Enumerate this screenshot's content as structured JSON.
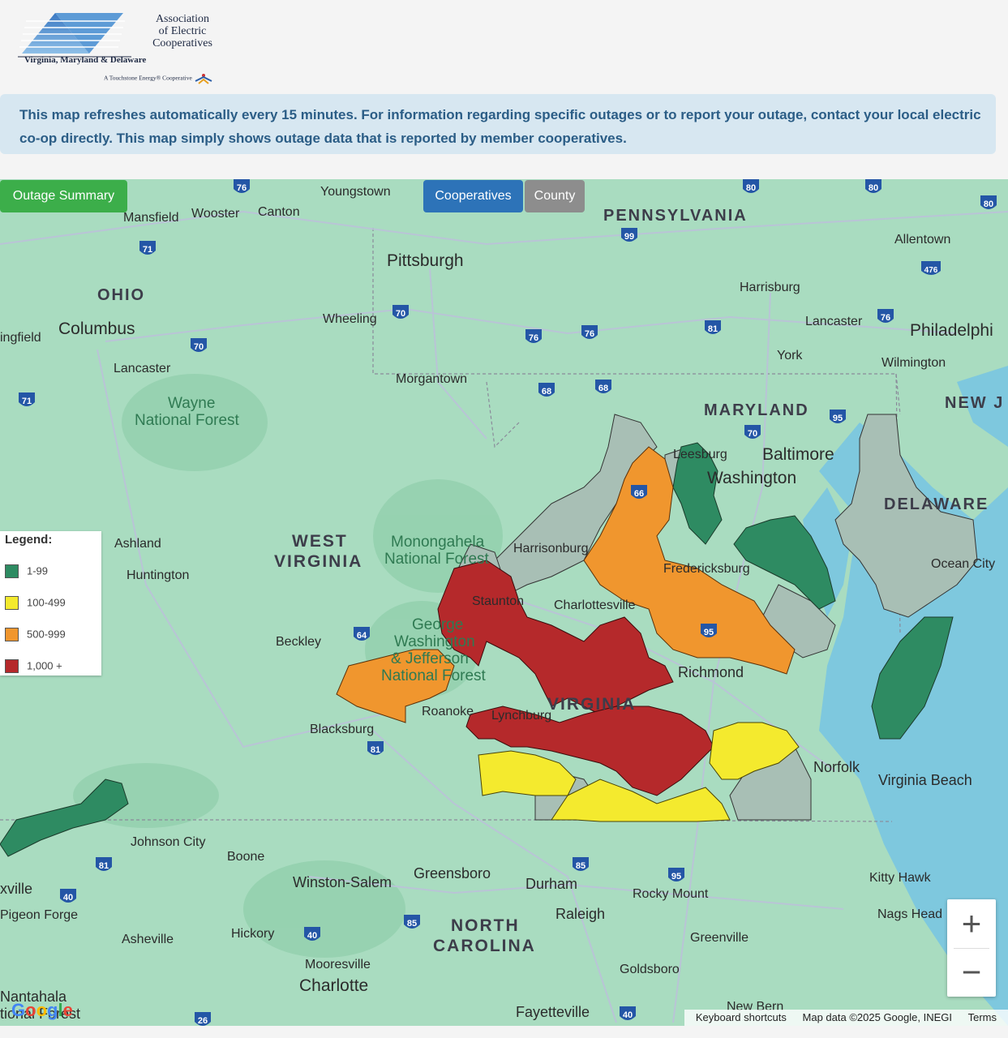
{
  "logo": {
    "name_line1": "Association",
    "name_line2": "of Electric",
    "name_line3": "Cooperatives",
    "states": "Virginia, Maryland & Delaware",
    "tagline": "A Touchstone Energy® Cooperative"
  },
  "banner": {
    "text": "This map refreshes automatically every 15 minutes. For information regarding specific outages or to report your outage, contact your local electric co-op directly. This map simply shows outage data that is reported by member cooperatives."
  },
  "buttons": {
    "outage_summary": "Outage Summary",
    "cooperatives": "Cooperatives",
    "county": "County"
  },
  "legend": {
    "title": "Legend:",
    "items": [
      {
        "label": "1-99",
        "color": "#2e8b62"
      },
      {
        "label": "100-499",
        "color": "#f4ea2e"
      },
      {
        "label": "500-999",
        "color": "#f0962e"
      },
      {
        "label": "1,000 +",
        "color": "#b5292b"
      }
    ]
  },
  "colors": {
    "no_outage": "#a8bfb5",
    "water": "#7ec8de",
    "land": "#a9dcc0"
  },
  "map_labels": {
    "states": [
      "PENNSYLVANIA",
      "OHIO",
      "MARYLAND",
      "NEW J",
      "WEST",
      "VIRGINIA",
      "DELAWARE",
      "NORTH",
      "CAROLINA",
      "VIRGINIA"
    ],
    "cities": [
      "Youngstown",
      "Mansfield",
      "Wooster",
      "Canton",
      "Pittsburgh",
      "Allentown",
      "Harrisburg",
      "Lancaster",
      "Philadelphi",
      "Wheeling",
      "Columbus",
      "ingfield",
      "Lancaster",
      "York",
      "Wilmington",
      "Morgantown",
      "Baltimore",
      "Washington",
      "Leesburg",
      "Ashland",
      "Huntington",
      "Harrisonburg",
      "Staunton",
      "Charlottesville",
      "Fredericksburg",
      "Ocean City",
      "Beckley",
      "Richmond",
      "Roanoke",
      "Lynchburg",
      "Blacksburg",
      "Norfolk",
      "Virginia Beach",
      "Johnson City",
      "Boone",
      "Winston-Salem",
      "Greensboro",
      "Durham",
      "Rocky Mount",
      "Kitty Hawk",
      "Raleigh",
      "Nags Head",
      "Hickory",
      "Asheville",
      "Greenville",
      "Mooresville",
      "Charlotte",
      "Goldsboro",
      "Fayetteville",
      "New Bern",
      "xville",
      "Pigeon Forge",
      "Nantahala",
      "tional Forest"
    ],
    "forests": [
      "Wayne",
      "National Forest",
      "Monongahela",
      "National Forest",
      "George",
      "Washington",
      "& Jefferson",
      "National Forest"
    ],
    "highways": [
      "76",
      "80",
      "80",
      "80",
      "71",
      "99",
      "476",
      "70",
      "76",
      "76",
      "81",
      "76",
      "70",
      "71",
      "68",
      "68",
      "70",
      "95",
      "66",
      "64",
      "95",
      "81",
      "81",
      "85",
      "95",
      "40",
      "85",
      "40",
      "26",
      "40"
    ]
  },
  "zoom": {
    "in": "+",
    "out": "−"
  },
  "attribution": {
    "shortcuts": "Keyboard shortcuts",
    "data": "Map data ©2025 Google, INEGI",
    "terms": "Terms"
  },
  "google": "Google"
}
